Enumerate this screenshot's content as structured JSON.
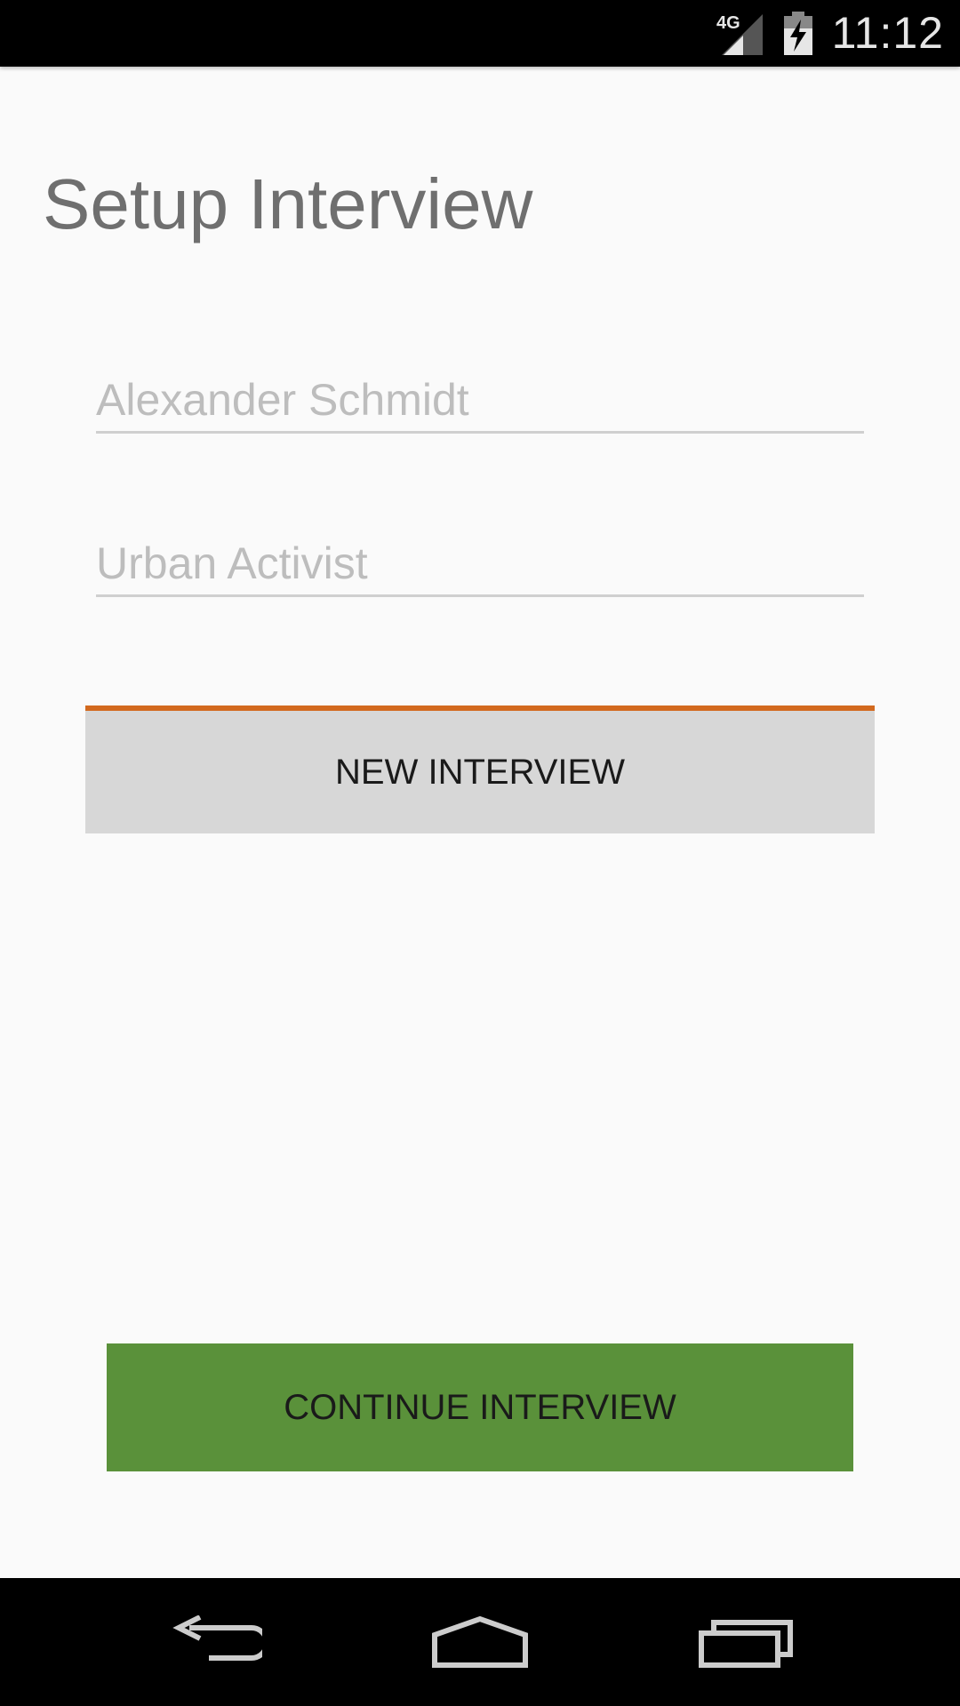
{
  "status_bar": {
    "network_label": "4G",
    "time": "11:12",
    "icons": [
      "signal-icon",
      "battery-charging-icon"
    ]
  },
  "page": {
    "title": "Setup Interview"
  },
  "form": {
    "name_placeholder": "Alexander Schmidt",
    "role_placeholder": "Urban Activist"
  },
  "buttons": {
    "new_interview": "NEW INTERVIEW",
    "continue_interview": "CONTINUE INTERVIEW"
  },
  "nav_bar": {
    "icons": [
      "back-icon",
      "home-icon",
      "recent-apps-icon"
    ]
  },
  "colors": {
    "accent": "#d2691e",
    "continue_button": "#5a913a",
    "new_button": "#d7d7d7",
    "background": "#fafafa"
  }
}
